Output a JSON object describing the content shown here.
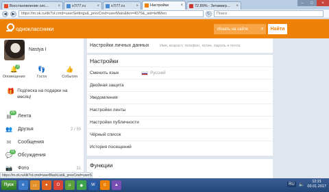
{
  "browser": {
    "tabs": [
      {
        "label": "Восстановление сес...",
        "color": "#e34a2a"
      },
      {
        "label": "x7/77.ru",
        "color": "#4a8ad4"
      },
      {
        "label": "x7/77.ru",
        "color": "#4a8ad4"
      },
      {
        "label": "Настройки",
        "color": "#ee8208",
        "active": true
      },
      {
        "label": "72.89% - Зетамагр...",
        "color": "#c9362b"
      }
    ],
    "url": "https://m.ok.ru/dk?st.cmd=userSettings&_prevCmd=userMain&tkn=4075&_aid=leftMen",
    "search_placeholder": "Поиск",
    "status_url": "https://m.ok.ru/dk?st.cmd=userBlackList&_prevCmd=userSettings&tkn=3225"
  },
  "site": {
    "brand": "одноклассники",
    "search_placeholder": "Искать на сайте",
    "search_button": "Найти"
  },
  "profile": {
    "name": "Nastya I",
    "counters": [
      {
        "label": "Оповещения",
        "icon": "bell-icon",
        "badge": "3"
      },
      {
        "label": "Гости",
        "icon": "footprints-icon",
        "badge": ""
      },
      {
        "label": "События",
        "icon": "events-icon",
        "badge": ""
      }
    ],
    "gift_text": "Подписка на подарки на месяц!"
  },
  "menu": [
    {
      "label": "Лента",
      "icon": "feed-icon",
      "badge": "26",
      "count": ""
    },
    {
      "label": "Друзья",
      "icon": "friends-icon",
      "badge": "",
      "count": "2 / 50"
    },
    {
      "label": "Сообщения",
      "icon": "messages-icon",
      "badge": "",
      "count": ""
    },
    {
      "label": "Обсуждения",
      "icon": "discussions-icon",
      "badge": "11",
      "count": ""
    },
    {
      "label": "Фото",
      "icon": "photo-icon",
      "badge": "",
      "count": "31"
    }
  ],
  "settings": {
    "personal_label": "Настройки личных данных",
    "personal_value": "Имя, возраст, телефон, логин, пароль и почта",
    "title": "Настройки",
    "rows": [
      "Сменить язык",
      "Двойная защита",
      "Уведомления",
      "Настройки ленты",
      "Настройки публичности",
      "Чёрный список",
      "История посещений"
    ],
    "language_value": "Русский",
    "functions_title": "Функции"
  },
  "taskbar": {
    "start_label": "Пуск",
    "lang": "RU",
    "time": "12:21",
    "date": "03.01.2017"
  }
}
